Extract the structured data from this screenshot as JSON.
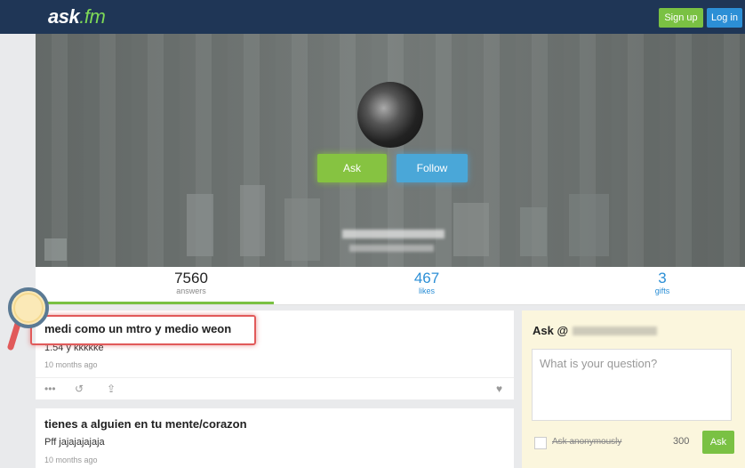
{
  "header": {
    "logo_main": "ask",
    "logo_ext": ".fm",
    "signup_label": "Sign up",
    "login_label": "Log in"
  },
  "profile": {
    "ask_label": "Ask",
    "follow_label": "Follow"
  },
  "stats": {
    "answers": {
      "count": "7560",
      "label": "answers"
    },
    "likes": {
      "count": "467",
      "label": "likes"
    },
    "gifts": {
      "count": "3",
      "label": "gifts"
    }
  },
  "feed": [
    {
      "question": "medi como un mtro y medio weon",
      "answer": "1.54 y kkkkke",
      "time": "10 months ago"
    },
    {
      "question": "tienes a alguien en tu mente/corazon",
      "answer": "Pff jajajajajaja",
      "time": "10 months ago"
    }
  ],
  "ask_panel": {
    "title": "Ask @",
    "placeholder": "What is your question?",
    "anonymous_label": "Ask anonymously",
    "char_count": "300",
    "submit_label": "Ask"
  },
  "colors": {
    "topbar": "#1f3656",
    "green": "#7ac143",
    "blue": "#2c8fd6",
    "highlight": "#e15a5a"
  }
}
